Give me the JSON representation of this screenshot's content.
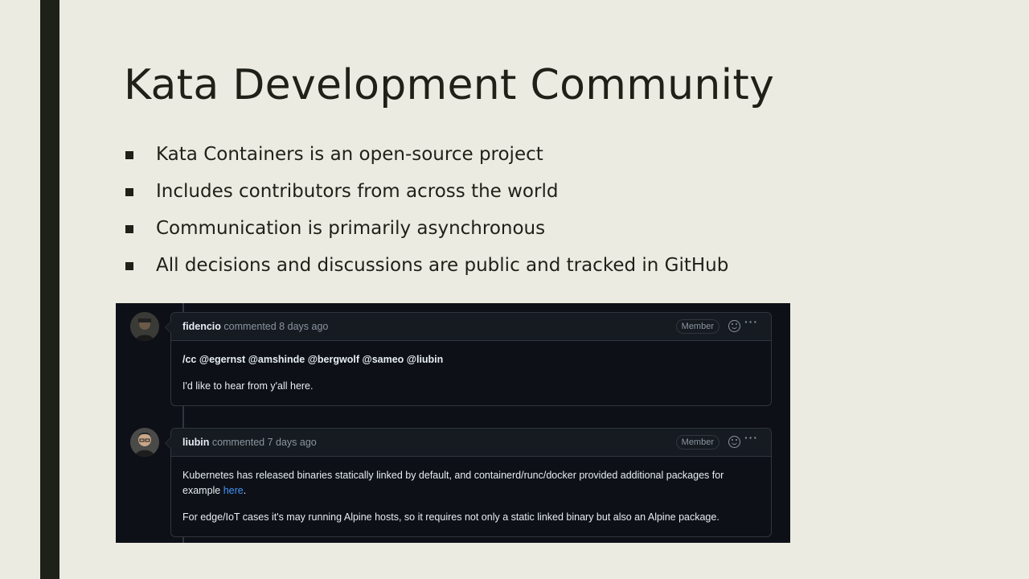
{
  "slide": {
    "title": "Kata Development Community",
    "bullets": [
      "Kata Containers is an open-source project",
      "Includes contributors from across the world",
      "Communication is primarily asynchronous",
      "All decisions and discussions are public and tracked in GitHub"
    ]
  },
  "github": {
    "comments": [
      {
        "author": "fidencio",
        "meta": "commented 8 days ago",
        "badge": "Member",
        "cc_prefix": "/cc",
        "mentions": [
          "@egernst",
          "@amshinde",
          "@bergwolf",
          "@sameo",
          "@liubin"
        ],
        "body2": "I'd like to hear from y'all here."
      },
      {
        "author": "liubin",
        "meta": "commented 7 days ago",
        "badge": "Member",
        "body1a": "Kubernetes has released binaries statically linked by default, and containerd/runc/docker provided additional packages for",
        "body1b": "example",
        "link": "here",
        "body1c": ".",
        "body2": "For edge/IoT cases it's may running Alpine hosts, so it requires not only a static linked binary but also an Alpine package."
      }
    ],
    "more_icon": "···",
    "colors": {
      "bg": "#0d1117",
      "header": "#161b22",
      "border": "#30363d",
      "link": "#4493f8"
    }
  }
}
